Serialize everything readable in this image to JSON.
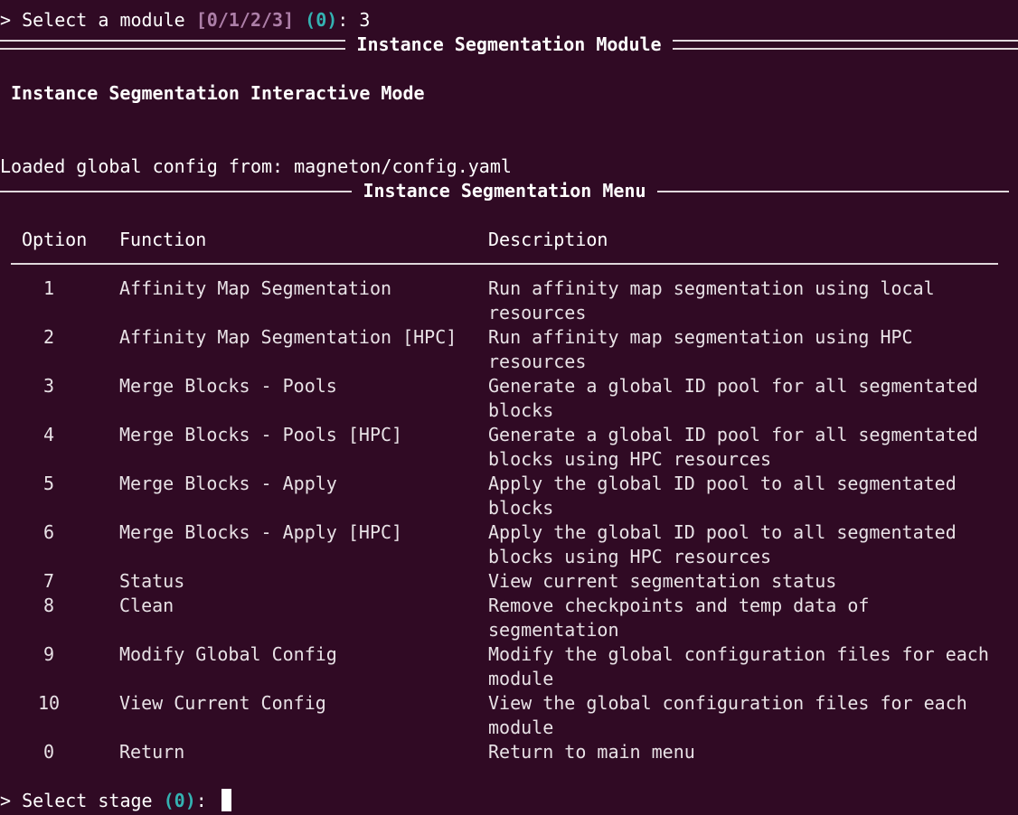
{
  "prompt_module": {
    "prefix": "> Select a module ",
    "choices": "[0/1/2/3]",
    "space": " ",
    "default": "(0)",
    "suffix": ": 3"
  },
  "module_banner": "Instance Segmentation Module",
  "mode_title": "Instance Segmentation Interactive Mode",
  "config_line": "Loaded global config from: magneton/config.yaml",
  "menu_title": "Instance Segmentation Menu",
  "table": {
    "headers": {
      "option": "Option",
      "function": "Function",
      "description": "Description"
    },
    "rows": [
      {
        "option": "1",
        "function": "Affinity Map Segmentation",
        "description": "Run affinity map segmentation using local resources"
      },
      {
        "option": "2",
        "function": "Affinity Map Segmentation [HPC]",
        "description": "Run affinity map segmentation using HPC resources"
      },
      {
        "option": "3",
        "function": "Merge Blocks - Pools",
        "description": "Generate a global ID pool for all segmentated blocks"
      },
      {
        "option": "4",
        "function": "Merge Blocks - Pools [HPC]",
        "description": "Generate a global ID pool for all segmentated blocks using HPC resources"
      },
      {
        "option": "5",
        "function": "Merge Blocks - Apply",
        "description": "Apply the global ID pool to all segmentated blocks"
      },
      {
        "option": "6",
        "function": "Merge Blocks - Apply [HPC]",
        "description": "Apply the global ID pool to all segmentated blocks using HPC resources"
      },
      {
        "option": "7",
        "function": "Status",
        "description": "View current segmentation status"
      },
      {
        "option": "8",
        "function": "Clean",
        "description": "Remove checkpoints and temp data of segmentation"
      },
      {
        "option": "9",
        "function": "Modify Global Config",
        "description": "Modify the global configuration files for each module"
      },
      {
        "option": "10",
        "function": "View Current Config",
        "description": "View the global configuration files for each module"
      },
      {
        "option": "0",
        "function": "Return",
        "description": "Return to main menu"
      }
    ]
  },
  "prompt_stage": {
    "prefix": "> Select stage ",
    "default": "(0)",
    "suffix": ": "
  },
  "colors": {
    "background": "#300a24",
    "text": "#ffffff",
    "choices": "#ad7fa8",
    "default": "#34b2b2"
  }
}
